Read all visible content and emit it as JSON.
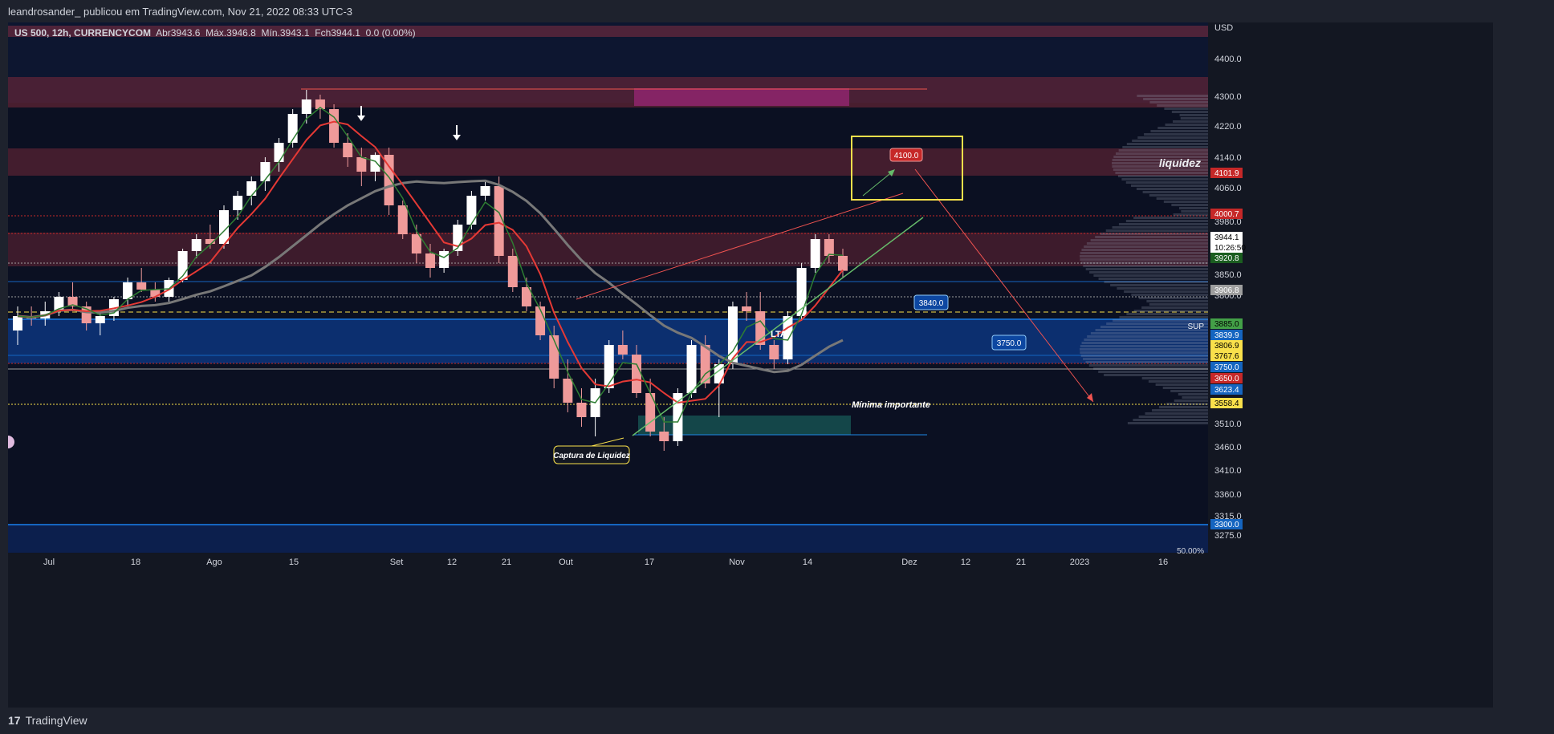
{
  "header": {
    "publish_line": "leandrosander_ publicou em TradingView.com, Nov 21, 2022 08:33 UTC-3"
  },
  "legend": {
    "symbol": "US 500, 12h, CURRENCYCOM",
    "open_label": "Abr",
    "open": "3943.6",
    "high_label": "Máx.",
    "high": "3946.8",
    "low_label": "Mín.",
    "low": "3943.1",
    "close_label": "Fch",
    "close": "3944.1",
    "change": "0.0 (0.00%)"
  },
  "footer": {
    "brand": "TradingView"
  },
  "colors": {
    "background": "#131722",
    "up": "#ffffff",
    "down": "#ef9a9a",
    "ema_red": "#e53935",
    "ema_green": "#2e7d32",
    "ma_gray": "#787878",
    "support_blue": "#1565c0",
    "resistance_zone": "#7b2a3a",
    "trendline": "#66bb6a"
  },
  "chart_data": {
    "type": "candlestick",
    "title": "US 500, 12h, CURRENCYCOM",
    "currency_label": "USD",
    "y_ticks": [
      "4400.0",
      "4300.0",
      "4220.0",
      "4140.0",
      "4060.0",
      "3980.0",
      "3850.0",
      "3800.0",
      "3510.0",
      "3460.0",
      "3410.0",
      "3360.0",
      "3315.0",
      "3275.0"
    ],
    "x_ticks": [
      "Jul",
      "18",
      "Ago",
      "15",
      "Set",
      "12",
      "21",
      "Out",
      "17",
      "Nov",
      "14",
      "Dez",
      "12",
      "21",
      "2023",
      "16"
    ],
    "price_labels": [
      {
        "value": "4101.9",
        "color": "#c62828"
      },
      {
        "value": "4000.7",
        "color": "#c62828"
      },
      {
        "value": "3944.1",
        "color": "#ffffff"
      },
      {
        "value": "10:26:50",
        "color": "#ffffff"
      },
      {
        "value": "3920.8",
        "color": "#1b5e20"
      },
      {
        "value": "3906.8",
        "color": "#9e9e9e"
      },
      {
        "value": "3885.0",
        "color": "#43a047"
      },
      {
        "value": "3839.9",
        "color": "#1565c0"
      },
      {
        "value": "3806.9",
        "color": "#f9e04b"
      },
      {
        "value": "3767.6",
        "color": "#f9e04b"
      },
      {
        "value": "3750.0",
        "color": "#1565c0"
      },
      {
        "value": "3650.0",
        "color": "#c62828"
      },
      {
        "value": "3623.4",
        "color": "#1565c0"
      },
      {
        "value": "3558.4",
        "color": "#f9e04b"
      },
      {
        "value": "3300.0",
        "color": "#1565c0"
      }
    ],
    "annotations": {
      "target_up": "4100.0",
      "target_mid": "3840.0",
      "target_low": "3750.0",
      "liquidity": "liquidez",
      "support": "SUP",
      "lta": "LTA",
      "important_low": "Mínima importante",
      "liquidity_capture": "Captura de Liquidez",
      "percent": "50.00%"
    },
    "candles": [
      [
        3820,
        3870,
        3790,
        3850
      ],
      [
        3850,
        3870,
        3830,
        3845
      ],
      [
        3845,
        3880,
        3830,
        3860
      ],
      [
        3860,
        3900,
        3850,
        3890
      ],
      [
        3890,
        3920,
        3860,
        3870
      ],
      [
        3870,
        3880,
        3820,
        3835
      ],
      [
        3835,
        3860,
        3810,
        3850
      ],
      [
        3850,
        3890,
        3840,
        3885
      ],
      [
        3885,
        3930,
        3870,
        3920
      ],
      [
        3920,
        3950,
        3900,
        3905
      ],
      [
        3905,
        3920,
        3880,
        3890
      ],
      [
        3890,
        3930,
        3880,
        3925
      ],
      [
        3925,
        3990,
        3920,
        3985
      ],
      [
        3985,
        4020,
        3970,
        4010
      ],
      [
        4010,
        4040,
        3990,
        4000
      ],
      [
        4000,
        4080,
        3990,
        4070
      ],
      [
        4070,
        4110,
        4050,
        4100
      ],
      [
        4100,
        4140,
        4080,
        4130
      ],
      [
        4130,
        4180,
        4110,
        4170
      ],
      [
        4170,
        4220,
        4150,
        4210
      ],
      [
        4210,
        4280,
        4200,
        4270
      ],
      [
        4270,
        4320,
        4250,
        4300
      ],
      [
        4300,
        4310,
        4260,
        4280
      ],
      [
        4280,
        4290,
        4200,
        4210
      ],
      [
        4210,
        4230,
        4160,
        4180
      ],
      [
        4180,
        4200,
        4120,
        4150
      ],
      [
        4150,
        4190,
        4130,
        4185
      ],
      [
        4185,
        4200,
        4060,
        4080
      ],
      [
        4080,
        4090,
        4010,
        4020
      ],
      [
        4020,
        4040,
        3960,
        3980
      ],
      [
        3980,
        4000,
        3930,
        3950
      ],
      [
        3950,
        3990,
        3940,
        3985
      ],
      [
        3985,
        4050,
        3975,
        4040
      ],
      [
        4040,
        4110,
        4030,
        4100
      ],
      [
        4100,
        4130,
        4090,
        4120
      ],
      [
        4120,
        4140,
        3960,
        3975
      ],
      [
        3975,
        3990,
        3900,
        3910
      ],
      [
        3910,
        3930,
        3860,
        3870
      ],
      [
        3870,
        3880,
        3800,
        3810
      ],
      [
        3810,
        3830,
        3700,
        3720
      ],
      [
        3720,
        3760,
        3650,
        3670
      ],
      [
        3670,
        3700,
        3620,
        3640
      ],
      [
        3640,
        3720,
        3600,
        3700
      ],
      [
        3700,
        3800,
        3690,
        3790
      ],
      [
        3790,
        3820,
        3760,
        3770
      ],
      [
        3770,
        3790,
        3680,
        3690
      ],
      [
        3690,
        3720,
        3600,
        3610
      ],
      [
        3610,
        3640,
        3570,
        3590
      ],
      [
        3590,
        3700,
        3580,
        3690
      ],
      [
        3690,
        3800,
        3680,
        3790
      ],
      [
        3790,
        3810,
        3700,
        3710
      ],
      [
        3710,
        3760,
        3640,
        3750
      ],
      [
        3750,
        3880,
        3740,
        3870
      ],
      [
        3870,
        3900,
        3840,
        3860
      ],
      [
        3860,
        3900,
        3780,
        3790
      ],
      [
        3790,
        3800,
        3740,
        3760
      ],
      [
        3760,
        3860,
        3750,
        3850
      ],
      [
        3850,
        3960,
        3840,
        3950
      ],
      [
        3950,
        4020,
        3940,
        4010
      ],
      [
        4010,
        4020,
        3960,
        3975
      ],
      [
        3975,
        3990,
        3930,
        3944
      ]
    ]
  }
}
